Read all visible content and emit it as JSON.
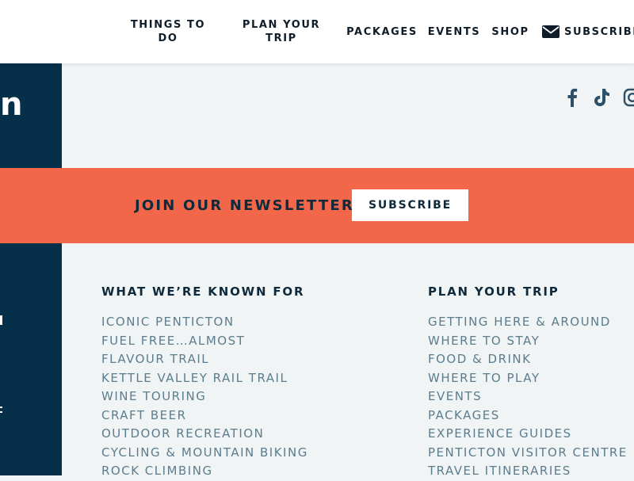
{
  "nav": {
    "items": [
      "THINGS TO DO",
      "PLAN YOUR TRIP",
      "PACKAGES",
      "EVENTS",
      "SHOP"
    ],
    "subscribe_label": "SUBSCRIBE"
  },
  "logo_fragment": "n",
  "social": {
    "icons": [
      "facebook-icon",
      "tiktok-icon",
      "instagram-icon"
    ]
  },
  "newsletter": {
    "title": "JOIN OUR NEWSLETTER",
    "button_label": "SUBSCRIBE"
  },
  "footer": {
    "columns": [
      {
        "heading": "WHAT WE’RE KNOWN FOR",
        "links": [
          "ICONIC PENTICTON",
          "FUEL FREE…ALMOST",
          "FLAVOUR TRAIL",
          "KETTLE VALLEY RAIL TRAIL",
          "WINE TOURING",
          "CRAFT BEER",
          "OUTDOOR RECREATION",
          "CYCLING & MOUNTAIN BIKING",
          "ROCK CLIMBING"
        ]
      },
      {
        "heading": "PLAN YOUR TRIP",
        "links": [
          "GETTING HERE & AROUND",
          "WHERE TO STAY",
          "FOOD & DRINK",
          "WHERE TO PLAY",
          "EVENTS",
          "PACKAGES",
          "EXPERIENCE GUIDES",
          "PENTICTON VISITOR CENTRE",
          "TRAVEL ITINERARIES"
        ]
      }
    ]
  },
  "colors": {
    "header_bg": "#ffffff",
    "page_bg": "#f1f4f5",
    "left_panel": "#06304a",
    "newsletter_bg": "#f26649",
    "heading_text": "#0f2a3d",
    "link_text": "#5b7d8e"
  }
}
